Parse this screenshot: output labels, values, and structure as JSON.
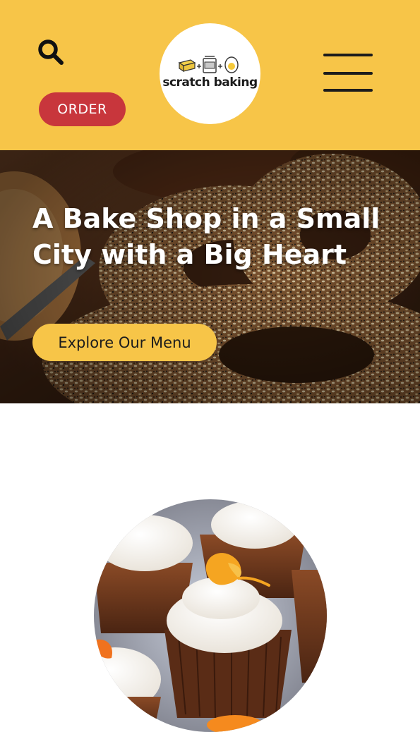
{
  "header": {
    "background_color": "#f7c548",
    "search_icon": "search-icon",
    "order_label": "ORDER",
    "order_color": "#c8363c",
    "logo_text": "scratch baking",
    "menu_icon": "hamburger-menu-icon"
  },
  "hero": {
    "title": "A Bake Shop in a Small City with a Big Heart",
    "cta_label": "Explore Our Menu",
    "cta_color": "#f7c548",
    "image": "bagels-photo"
  },
  "feature": {
    "image": "cupcakes-photo"
  }
}
